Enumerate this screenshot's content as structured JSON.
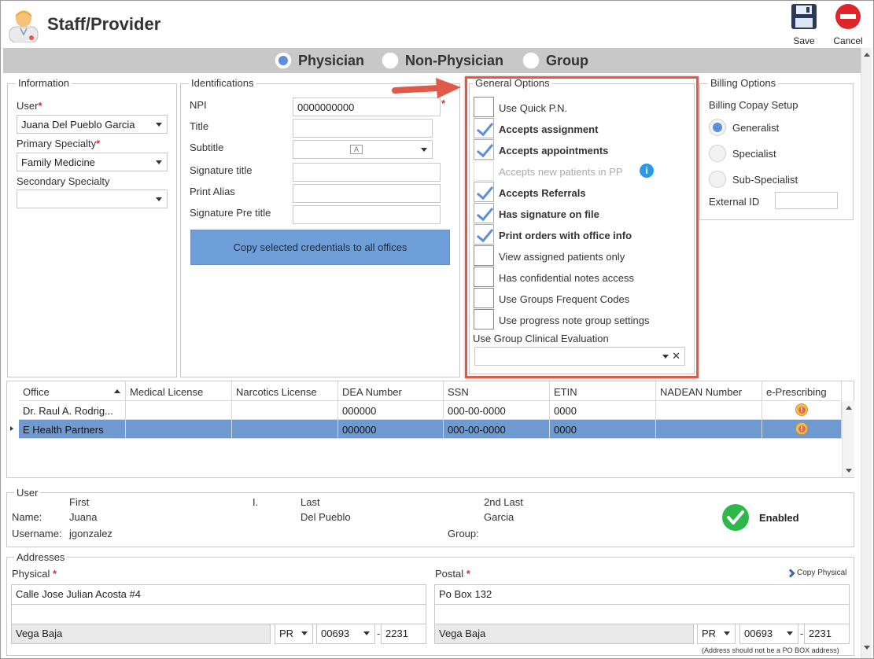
{
  "window": {
    "title": "Staff/Provider"
  },
  "toolbar": {
    "save_label": "Save",
    "cancel_label": "Cancel"
  },
  "provider_type": {
    "options": [
      "Physician",
      "Non-Physician",
      "Group"
    ],
    "selected": "Physician"
  },
  "information": {
    "legend": "Information",
    "user_label": "User",
    "user_value": "Juana Del Pueblo Garcia",
    "primary_specialty_label": "Primary Specialty",
    "primary_specialty_value": "Family Medicine",
    "secondary_specialty_label": "Secondary Specialty",
    "secondary_specialty_value": ""
  },
  "identifications": {
    "legend": "Identifications",
    "npi_label": "NPI",
    "npi_value": "0000000000",
    "title_label": "Title",
    "subtitle_label": "Subtitle",
    "signature_title_label": "Signature title",
    "print_alias_label": "Print Alias",
    "signature_pre_title_label": "Signature Pre title",
    "copy_button": "Copy selected credentials to all offices"
  },
  "general_options": {
    "legend": "General Options",
    "items": [
      {
        "label": "Use Quick P.N.",
        "checked": false,
        "bold": false,
        "disabled": false
      },
      {
        "label": "Accepts assignment",
        "checked": true,
        "bold": true,
        "disabled": false
      },
      {
        "label": "Accepts appointments",
        "checked": true,
        "bold": true,
        "disabled": false
      },
      {
        "label": "Accepts new patients in PP",
        "checked": false,
        "bold": false,
        "disabled": true
      },
      {
        "label": "Accepts Referrals",
        "checked": true,
        "bold": true,
        "disabled": false
      },
      {
        "label": "Has signature on file",
        "checked": true,
        "bold": true,
        "disabled": false
      },
      {
        "label": "Print orders with office info",
        "checked": true,
        "bold": true,
        "disabled": false
      },
      {
        "label": "View assigned patients only",
        "checked": false,
        "bold": false,
        "disabled": false
      },
      {
        "label": "Has confidential notes access",
        "checked": false,
        "bold": false,
        "disabled": false
      },
      {
        "label": "Use Groups Frequent Codes",
        "checked": false,
        "bold": false,
        "disabled": false
      },
      {
        "label": "Use progress note group settings",
        "checked": false,
        "bold": false,
        "disabled": false
      }
    ],
    "clinical_eval_label": "Use Group Clinical Evaluation",
    "clinical_eval_value": ""
  },
  "billing_options": {
    "legend": "Billing Options",
    "copay_label": "Billing Copay Setup",
    "options": [
      "Generalist",
      "Specialist",
      "Sub-Specialist"
    ],
    "selected": "Generalist",
    "external_id_label": "External ID",
    "external_id_value": ""
  },
  "offices_table": {
    "columns": [
      "Office",
      "Medical License",
      "Narcotics License",
      "DEA Number",
      "SSN",
      "ETIN",
      "NADEAN Number",
      "e-Prescribing"
    ],
    "rows": [
      [
        "Dr. Raul A. Rodrig...",
        "",
        "",
        "000000",
        "000-00-0000",
        "0000",
        "",
        ""
      ],
      [
        "E Health Partners",
        "",
        "",
        "000000",
        "000-00-0000",
        "0000",
        "",
        ""
      ]
    ],
    "selected_row": 1
  },
  "user_section": {
    "legend": "User",
    "first_header": "First",
    "initial_header": "I.",
    "last_header": "Last",
    "second_last_header": "2nd Last",
    "name_label": "Name:",
    "first": "Juana",
    "last": "Del Pueblo",
    "second_last": "Garcia",
    "username_label": "Username:",
    "username": "jgonzalez",
    "group_label": "Group:",
    "status": "Enabled"
  },
  "addresses": {
    "legend": "Addresses",
    "physical_label": "Physical",
    "postal_label": "Postal",
    "copy_physical": "Copy Physical",
    "physical": {
      "line1": "Calle Jose Julian Acosta #4",
      "line2": "",
      "city": "Vega Baja",
      "state": "PR",
      "zip": "00693",
      "zip4": "2231"
    },
    "postal": {
      "line1": "Po Box 132",
      "line2": "",
      "city": "Vega Baja",
      "state": "PR",
      "zip": "00693",
      "zip4": "2231"
    },
    "note": "(Address should not be a PO BOX address)"
  },
  "colors": {
    "accent": "#5b8fd9",
    "selected_row": "#6e9ad0",
    "highlight_box": "#e05a4a",
    "enabled_green": "#2eb84a",
    "cancel_red": "#e0242c"
  }
}
